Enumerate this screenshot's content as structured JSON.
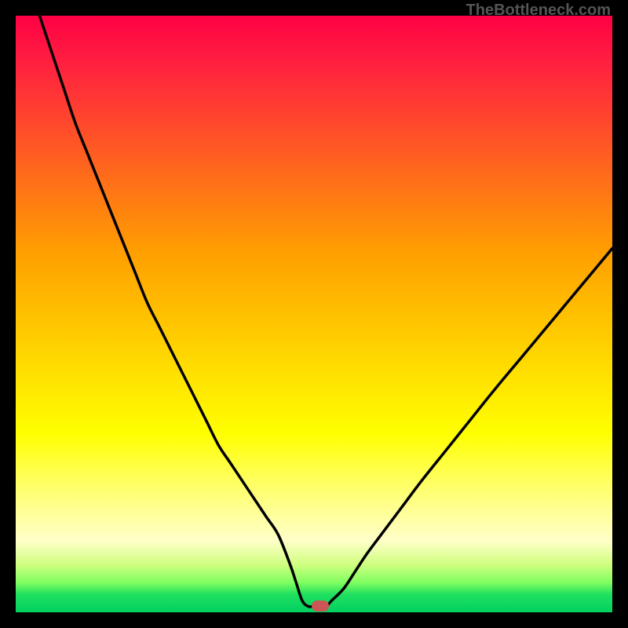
{
  "attribution": "TheBottleneck.com",
  "colors": {
    "border": "#000000",
    "curve": "#000000",
    "marker": "#cc5555",
    "gradient_top": "#ff0044",
    "gradient_bottom": "#00d060"
  },
  "chart_data": {
    "type": "line",
    "title": "",
    "xlabel": "",
    "ylabel": "",
    "xlim": [
      0,
      100
    ],
    "ylim": [
      0,
      100
    ],
    "x": [
      4,
      6,
      8,
      10,
      12,
      14,
      16,
      18,
      20,
      22,
      24,
      26,
      28,
      30,
      32,
      34,
      36,
      38,
      40,
      42,
      44,
      46,
      47,
      48,
      49,
      50,
      51,
      52,
      53,
      55,
      57,
      59,
      62,
      65,
      68,
      72,
      76,
      80,
      85,
      90,
      95,
      100
    ],
    "y": [
      100,
      94,
      88,
      82,
      77,
      72,
      67,
      62,
      57,
      52,
      48,
      44,
      40,
      36,
      32,
      28,
      25,
      22,
      19,
      16,
      13,
      8,
      5,
      2,
      1,
      1,
      1,
      1,
      2,
      4,
      7,
      10,
      14,
      18,
      22,
      27,
      32,
      37,
      43,
      49,
      55,
      61
    ],
    "marker": {
      "x": 51,
      "y": 1
    },
    "legend": false,
    "grid": false
  }
}
